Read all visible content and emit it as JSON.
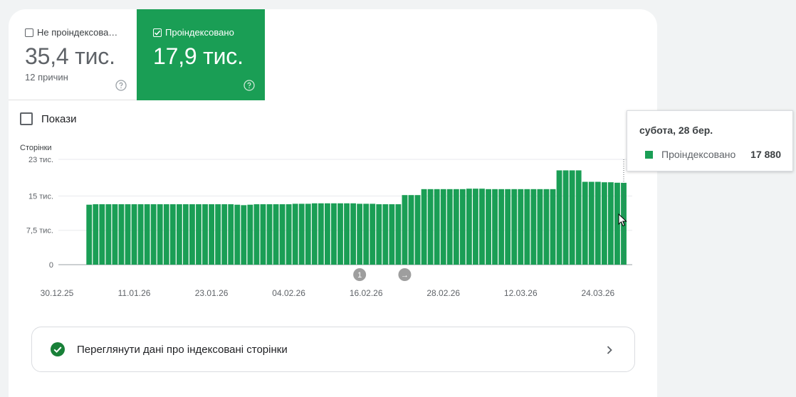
{
  "tiles": {
    "not_indexed": {
      "label": "Не проіндексова…",
      "value": "35,4 тис.",
      "sub": "12 причин",
      "checked": false
    },
    "indexed": {
      "label": "Проіндексовано",
      "value": "17,9 тис.",
      "checked": true
    }
  },
  "impressions_label": "Покази",
  "colors": {
    "accent": "#1a9e55",
    "marker": "#9e9e9e"
  },
  "chart_data": {
    "type": "bar",
    "ylabel": "Сторінки",
    "y_ticks": [
      "23 тис.",
      "15 тис.",
      "7,5 тис.",
      "0"
    ],
    "y_tick_values": [
      23000,
      15000,
      7500,
      0
    ],
    "ylim": [
      0,
      23000
    ],
    "x_tick_labels": [
      "30.12.25",
      "11.01.26",
      "23.01.26",
      "04.02.26",
      "16.02.26",
      "28.02.26",
      "12.03.26",
      "24.03.26"
    ],
    "x_start": "30.12.25",
    "x_end": "28.03.26",
    "first_data_date": "04.01.26",
    "series": [
      {
        "name": "Проіндексовано",
        "color": "#1a9e55",
        "values": [
          13100,
          13200,
          13200,
          13200,
          13200,
          13200,
          13200,
          13200,
          13200,
          13200,
          13200,
          13200,
          13200,
          13200,
          13200,
          13200,
          13200,
          13200,
          13200,
          13200,
          13200,
          13200,
          13200,
          13100,
          13000,
          13100,
          13200,
          13200,
          13200,
          13200,
          13200,
          13200,
          13300,
          13300,
          13300,
          13400,
          13400,
          13400,
          13400,
          13400,
          13400,
          13400,
          13300,
          13300,
          13300,
          13200,
          13200,
          13200,
          13200,
          15200,
          15200,
          15200,
          16500,
          16500,
          16500,
          16500,
          16500,
          16500,
          16500,
          16600,
          16600,
          16600,
          16500,
          16500,
          16500,
          16500,
          16500,
          16500,
          16500,
          16500,
          16500,
          16500,
          16500,
          20600,
          20600,
          20600,
          20600,
          18100,
          18100,
          18100,
          18000,
          18000,
          17900,
          17880
        ]
      }
    ],
    "markers": [
      {
        "label": "1",
        "date": "15.02.26"
      },
      {
        "label": "→",
        "date": "22.02.26"
      }
    ]
  },
  "tooltip": {
    "date": "субота, 28 бер.",
    "series": "Проіндексовано",
    "value": "17 880"
  },
  "link_card": {
    "label": "Переглянути дані про індексовані сторінки"
  }
}
